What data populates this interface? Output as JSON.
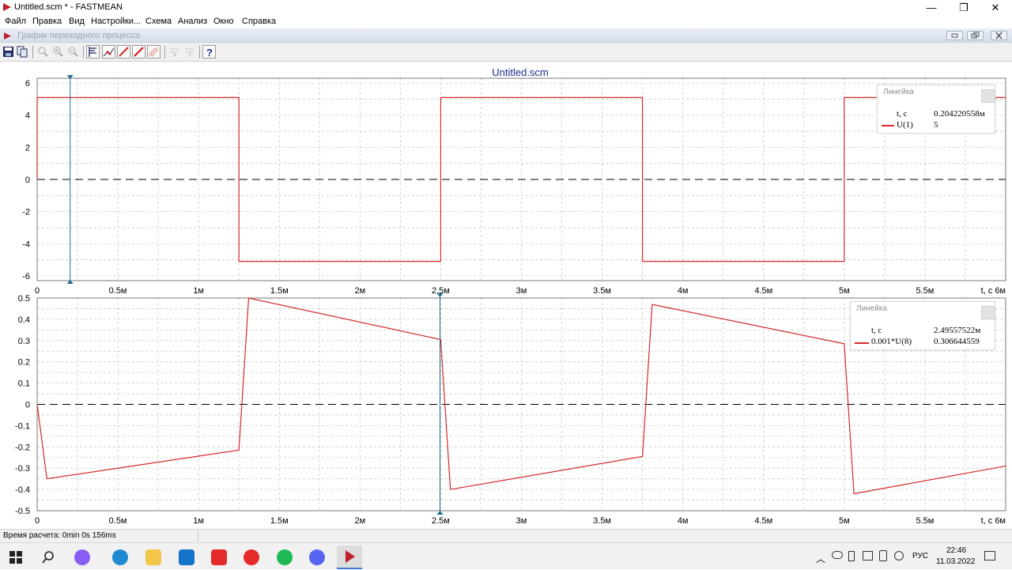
{
  "window": {
    "title": "Untitled.scm * - FASTMEAN",
    "controls": {
      "minimize": "—",
      "maximize": "❐",
      "close": "✕"
    }
  },
  "menu": [
    "Файл",
    "Правка",
    "Вид",
    "Настройки...",
    "Схема",
    "Анализ",
    "Окно",
    "Справка"
  ],
  "child_window": {
    "title": "График переходного процесса"
  },
  "toolbar": [
    "save-icon",
    "copy-icon",
    "zoom-out-icon",
    "zoom-in-icon",
    "zoom-reset-icon",
    "cursor-icon",
    "markers-icon",
    "line-red-icon",
    "line-red2-icon",
    "grid-icon",
    "log-x-icon",
    "log-y-icon",
    "help-icon"
  ],
  "colors": {
    "trace": "#d42a2a",
    "cursor": "#1d6c8c",
    "title": "#1a2b8c",
    "grid": "#c9c9c9"
  },
  "chart_data": [
    {
      "type": "line",
      "title": "Untitled.scm",
      "xlabel": "t, c",
      "xlim": [
        0,
        6
      ],
      "ylim": [
        -6.3,
        6.3
      ],
      "x_ticks": [
        "0",
        "0.5м",
        "1м",
        "1.5м",
        "2м",
        "2.5м",
        "3м",
        "3.5м",
        "4м",
        "4.5м",
        "5м",
        "5.5м",
        "t, c 6м"
      ],
      "y_ticks": [
        "6",
        "4",
        "2",
        "0",
        "-2",
        "-4",
        "-6"
      ],
      "grid": true,
      "series": [
        {
          "name": "U(1)",
          "x": [
            0,
            0,
            1.25,
            1.25,
            2.5,
            2.5,
            3.75,
            3.75,
            5.0,
            5.0,
            6.0
          ],
          "y": [
            0,
            5.1,
            5.1,
            -5.1,
            -5.1,
            5.1,
            5.1,
            -5.1,
            -5.1,
            5.1,
            5.1
          ]
        }
      ],
      "cursor": {
        "x": 0.204220558,
        "label": "Линейка",
        "t_label": "t, c",
        "t_value": "0.204220558м",
        "series_label": "U(1)",
        "series_value": "5"
      }
    },
    {
      "type": "line",
      "xlabel": "t, c",
      "xlim": [
        0,
        6
      ],
      "ylim": [
        -0.5,
        0.5
      ],
      "x_ticks": [
        "0",
        "0.5м",
        "1м",
        "1.5м",
        "2м",
        "2.5м",
        "3м",
        "3.5м",
        "4м",
        "4.5м",
        "5м",
        "5.5м",
        "t, c 6м"
      ],
      "y_ticks": [
        "0.5",
        "0.4",
        "0.3",
        "0.2",
        "0.1",
        "0",
        "-0.1",
        "-0.2",
        "-0.3",
        "-0.4",
        "-0.5"
      ],
      "grid": true,
      "series": [
        {
          "name": "0.001*U(8)",
          "x": [
            0,
            0.06,
            1.25,
            1.31,
            2.5,
            2.56,
            3.75,
            3.81,
            5.0,
            5.06,
            6.0
          ],
          "y": [
            0,
            -0.35,
            -0.215,
            0.5,
            0.305,
            -0.4,
            -0.245,
            0.47,
            0.285,
            -0.42,
            -0.29
          ]
        }
      ],
      "cursor": {
        "x": 2.49557522,
        "label": "Линейка",
        "t_label": "t, c",
        "t_value": "2.49557522м",
        "series_label": "0.001*U(8)",
        "series_value": "0.306644559"
      }
    }
  ],
  "status": {
    "text": "Время расчета: 0min 0s 156ms"
  },
  "taskbar": {
    "icons": [
      "windows-start-icon",
      "search-icon",
      "alice-icon",
      "edge-icon",
      "explorer-icon",
      "mail-icon",
      "yandex-icon",
      "yandex-browser-icon",
      "spotify-icon",
      "discord-icon",
      "fastmean-icon"
    ],
    "lang": "РУС",
    "time": "22:46",
    "date": "11.03.2022"
  }
}
